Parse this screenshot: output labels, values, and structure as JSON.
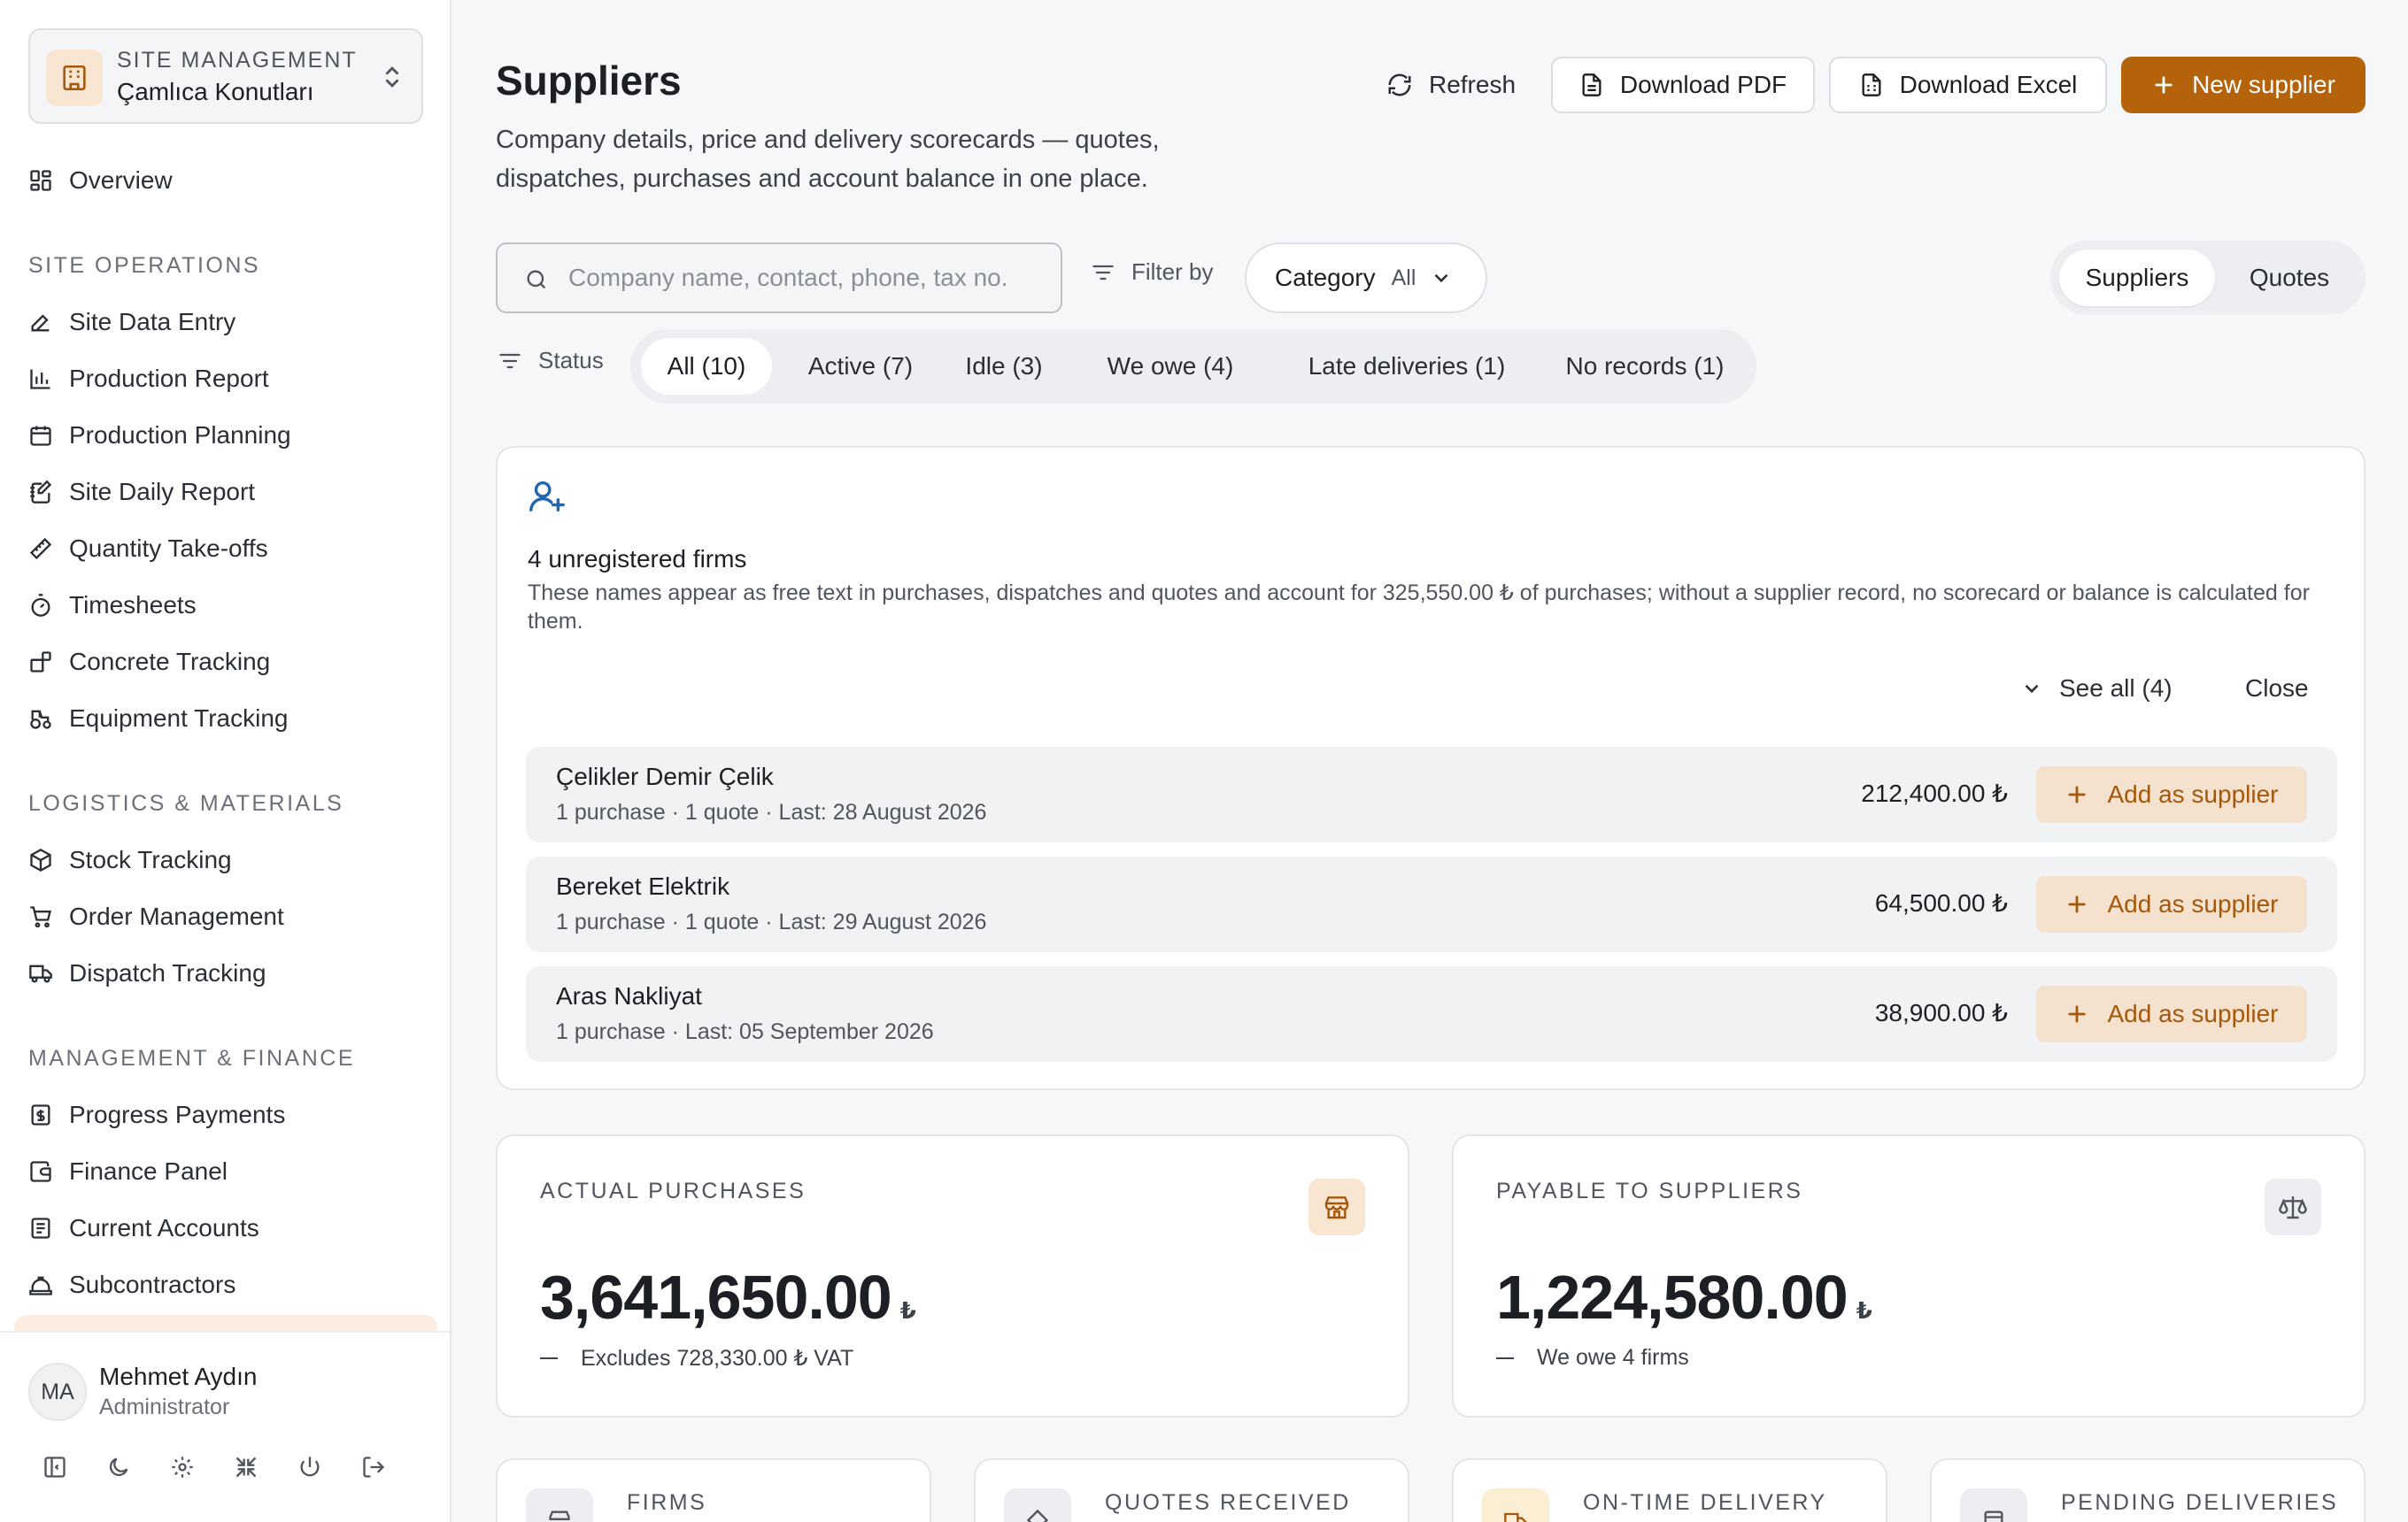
{
  "sidebar": {
    "site_switcher": {
      "label": "SITE MANAGEMENT",
      "value": "Çamlıca Konutları"
    },
    "overview": "Overview",
    "sections": [
      {
        "title": "SITE OPERATIONS",
        "items": [
          "Site Data Entry",
          "Production Report",
          "Production Planning",
          "Site Daily Report",
          "Quantity Take-offs",
          "Timesheets",
          "Concrete Tracking",
          "Equipment Tracking"
        ]
      },
      {
        "title": "LOGISTICS & MATERIALS",
        "items": [
          "Stock Tracking",
          "Order Management",
          "Dispatch Tracking"
        ]
      },
      {
        "title": "MANAGEMENT & FINANCE",
        "items": [
          "Progress Payments",
          "Finance Panel",
          "Current Accounts",
          "Subcontractors"
        ]
      }
    ],
    "user": {
      "initials": "MA",
      "name": "Mehmet Aydın",
      "role": "Administrator"
    }
  },
  "header": {
    "title": "Suppliers",
    "subtitle": "Company details, price and delivery scorecards — quotes, dispatches, purchases and account balance in one place.",
    "refresh": "Refresh",
    "download_pdf": "Download PDF",
    "download_excel": "Download Excel",
    "new_supplier": "New supplier"
  },
  "filters": {
    "search_placeholder": "Company name, contact, phone, tax no.",
    "filter_by": "Filter by",
    "category_label": "Category",
    "category_value": "All",
    "view_tabs": [
      "Suppliers",
      "Quotes"
    ],
    "active_view": "Suppliers",
    "status_label": "Status",
    "status_chips": [
      "All (10)",
      "Active (7)",
      "Idle (3)",
      "We owe (4)",
      "Late deliveries (1)",
      "No records (1)"
    ],
    "active_status": "All (10)"
  },
  "unregistered": {
    "title": "4 unregistered firms",
    "description": "These names appear as free text in purchases, dispatches and quotes and account for 325,550.00 ₺ of purchases; without a supplier record, no scorecard or balance is calculated for them.",
    "see_all": "See all (4)",
    "close": "Close",
    "add_label": "Add as supplier",
    "firms": [
      {
        "name": "Çelikler Demir Çelik",
        "meta": "1 purchase · 1 quote · Last: 28 August 2026",
        "amount": "212,400.00 ₺"
      },
      {
        "name": "Bereket Elektrik",
        "meta": "1 purchase · 1 quote · Last: 29 August 2026",
        "amount": "64,500.00 ₺"
      },
      {
        "name": "Aras Nakliyat",
        "meta": "1 purchase · Last: 05 September 2026",
        "amount": "38,900.00 ₺"
      }
    ]
  },
  "stats": {
    "actual_purchases": {
      "label": "ACTUAL PURCHASES",
      "value": "3,641,650.00",
      "currency": "₺",
      "note": "Excludes 728,330.00 ₺ VAT"
    },
    "payable": {
      "label": "PAYABLE TO SUPPLIERS",
      "value": "1,224,580.00",
      "currency": "₺",
      "note": "We owe 4 firms"
    }
  },
  "mini_stats": [
    "FIRMS",
    "QUOTES RECEIVED",
    "ON-TIME DELIVERY",
    "PENDING DELIVERIES"
  ],
  "colors": {
    "accent": "#b4630b",
    "accent_soft": "#f4e2cf",
    "link_icon": "#1f66b3"
  }
}
